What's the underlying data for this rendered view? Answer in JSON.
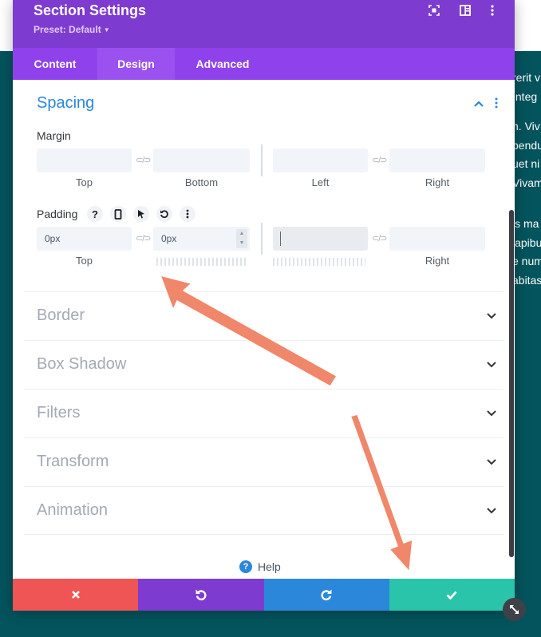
{
  "header": {
    "title": "Section Settings",
    "preset": "Preset: Default"
  },
  "tabs": [
    {
      "label": "Content",
      "active": false
    },
    {
      "label": "Design",
      "active": true
    },
    {
      "label": "Advanced",
      "active": false
    }
  ],
  "spacing": {
    "title": "Spacing",
    "margin": {
      "label": "Margin",
      "top_label": "Top",
      "bottom_label": "Bottom",
      "left_label": "Left",
      "right_label": "Right",
      "top_value": "",
      "bottom_value": "",
      "left_value": "",
      "right_value": ""
    },
    "padding": {
      "label": "Padding",
      "top_label": "Top",
      "right_label": "Right",
      "top_value": "0px",
      "bottom_value": "0px",
      "left_value": "",
      "right_value": ""
    }
  },
  "groups": [
    {
      "title": "Border"
    },
    {
      "title": "Box Shadow"
    },
    {
      "title": "Filters"
    },
    {
      "title": "Transform"
    },
    {
      "title": "Animation"
    }
  ],
  "help": {
    "label": "Help"
  },
  "background_text": [
    "rerit v",
    "Integ",
    "n. Viv",
    "pendu",
    "uet ni",
    "Vivam",
    "is ma",
    "lapibu",
    "e num",
    "abitas"
  ],
  "colors": {
    "header": "#7e3bd0",
    "tabs": "#8f42ec",
    "accent_blue": "#2b87da",
    "cancel": "#ef5555",
    "undo": "#7e3bd0",
    "redo": "#2b87da",
    "save": "#29c4a9",
    "page_teal": "#04545d",
    "annotation_arrow": "#f0876a"
  },
  "icons": {
    "expand": "expand-icon",
    "split_view": "split-view-icon",
    "more": "more-vertical-icon",
    "cancel": "close-icon",
    "undo": "undo-icon",
    "redo": "redo-icon",
    "save": "checkmark-icon"
  }
}
